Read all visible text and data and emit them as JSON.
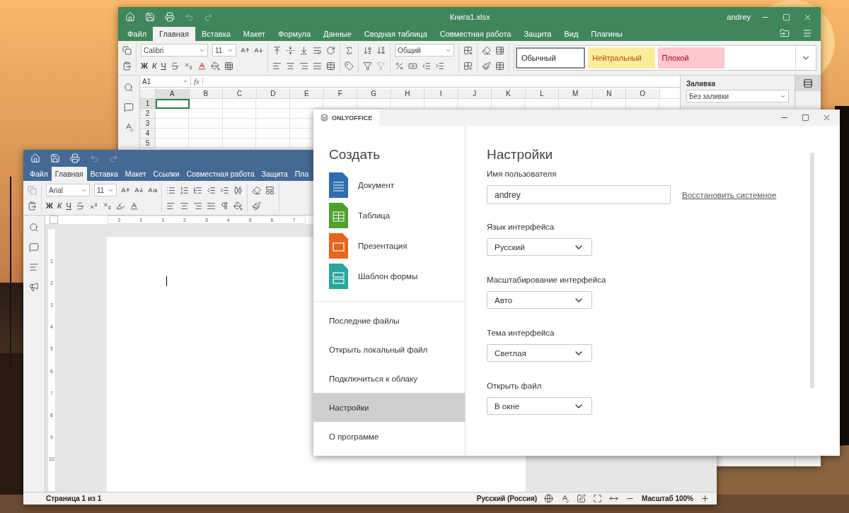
{
  "spreadsheet": {
    "title": "Книга1.xlsx",
    "user": "andrey",
    "tabs": [
      {
        "label": "Файл",
        "selected": false
      },
      {
        "label": "Главная",
        "selected": true
      },
      {
        "label": "Вставка",
        "selected": false
      },
      {
        "label": "Макет",
        "selected": false
      },
      {
        "label": "Формула",
        "selected": false
      },
      {
        "label": "Данные",
        "selected": false
      },
      {
        "label": "Сводная таблица",
        "selected": false
      },
      {
        "label": "Совместная работа",
        "selected": false
      },
      {
        "label": "Защита",
        "selected": false
      },
      {
        "label": "Вид",
        "selected": false
      },
      {
        "label": "Плагины",
        "selected": false
      }
    ],
    "font": "Calibri",
    "size": "11",
    "format_labels": [
      "Ж",
      "К",
      "Ч"
    ],
    "number_format": "Общий",
    "styles": [
      {
        "label": "Обычный",
        "kind": "normal"
      },
      {
        "label": "Нейтральный",
        "kind": "neutral"
      },
      {
        "label": "Плохой",
        "kind": "bad"
      },
      {
        "kind": "blank"
      }
    ],
    "cell_ref": "A1",
    "fx": "fx",
    "columns": [
      {
        "label": "A",
        "selected": true
      },
      {
        "label": "B",
        "selected": false
      },
      {
        "label": "C",
        "selected": false
      },
      {
        "label": "D",
        "selected": false
      },
      {
        "label": "E",
        "selected": false
      },
      {
        "label": "F",
        "selected": false
      },
      {
        "label": "G",
        "selected": false
      },
      {
        "label": "H",
        "selected": false
      },
      {
        "label": "I",
        "selected": false
      },
      {
        "label": "J",
        "selected": false
      },
      {
        "label": "K",
        "selected": false
      },
      {
        "label": "L",
        "selected": false
      },
      {
        "label": "M",
        "selected": false
      },
      {
        "label": "N",
        "selected": false
      },
      {
        "label": "O",
        "selected": false
      }
    ],
    "rows": [
      {
        "label": "1",
        "selected": true
      },
      {
        "label": "2",
        "selected": false
      },
      {
        "label": "3",
        "selected": false
      },
      {
        "label": "4",
        "selected": false
      },
      {
        "label": "5",
        "selected": false
      }
    ],
    "panel": {
      "title": "Заливка",
      "fill": "Без заливки"
    }
  },
  "document": {
    "tabs": [
      {
        "label": "Файл",
        "selected": false
      },
      {
        "label": "Главная",
        "selected": true
      },
      {
        "label": "Вставка",
        "selected": false
      },
      {
        "label": "Макет",
        "selected": false
      },
      {
        "label": "Ссылки",
        "selected": false
      },
      {
        "label": "Совместная работа",
        "selected": false
      },
      {
        "label": "Защита",
        "selected": false
      },
      {
        "label": "Пла",
        "selected": false
      }
    ],
    "font": "Arial",
    "size": "11",
    "format_labels": [
      "Ж",
      "К",
      "Ч"
    ],
    "ruler_labels": [
      "2",
      "1",
      "1",
      "2",
      "3",
      "4",
      "5",
      "6",
      "7"
    ],
    "vertical_ruler_labels": [
      "1",
      "2",
      "3",
      "4",
      "5",
      "6",
      "7",
      "8",
      "9",
      "10"
    ],
    "status": {
      "page": "Страница 1 из 1",
      "language": "Русский (Россия)",
      "zoom": "Масштаб 100%"
    }
  },
  "dialog": {
    "brand": "ONLYOFFICE",
    "create_title": "Создать",
    "create_items": [
      {
        "label": "Документ",
        "kind": "document"
      },
      {
        "label": "Таблица",
        "kind": "spreadsheet"
      },
      {
        "label": "Презентация",
        "kind": "presentation"
      },
      {
        "label": "Шаблон формы",
        "kind": "form"
      }
    ],
    "nav": [
      {
        "label": "Последние файлы",
        "selected": false
      },
      {
        "label": "Открыть локальный файл",
        "selected": false
      },
      {
        "label": "Подключиться к облаку",
        "selected": false
      },
      {
        "label": "Настройки",
        "selected": true
      },
      {
        "label": "О программе",
        "selected": false
      }
    ],
    "settings_title": "Настройки",
    "username_label": "Имя пользователя",
    "username": "andrey",
    "restore_link": "Восстановить системное",
    "selects": [
      {
        "label": "Язык интерфейса",
        "value": "Русский"
      },
      {
        "label": "Масштабирование интерфейса",
        "value": "Авто"
      },
      {
        "label": "Тема интерфейса",
        "value": "Светлая"
      },
      {
        "label": "Открыть файл",
        "value": "В окне"
      }
    ]
  }
}
